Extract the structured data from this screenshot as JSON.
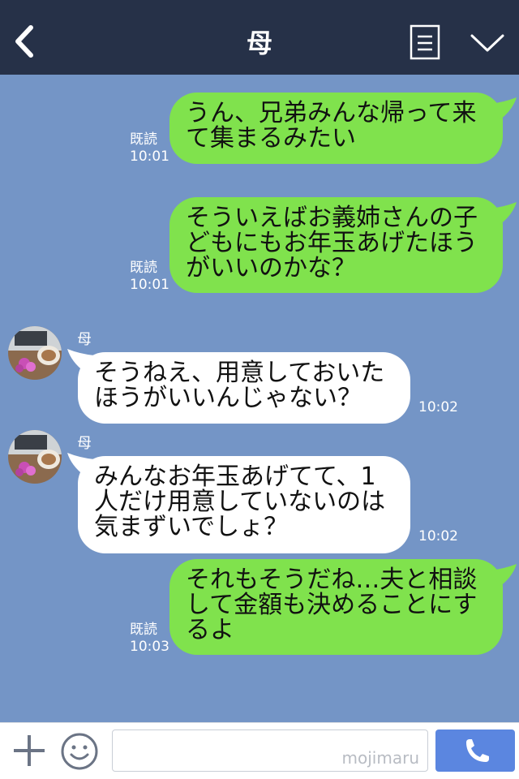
{
  "header": {
    "title": "母"
  },
  "messages": [
    {
      "from": "me",
      "lines": [
        "うん、兄弟みんな帰って来",
        "て集まるみたい"
      ],
      "read": "既読",
      "time": "10:01"
    },
    {
      "from": "me",
      "lines": [
        "そういえばお義姉さんの子",
        "どもにもお年玉あげたほう",
        "がいいのかな？"
      ],
      "read": "既読",
      "time": "10:01"
    },
    {
      "from": "them",
      "sender": "母",
      "lines": [
        "そうねえ、用意しておいた",
        "ほうがいいんじゃない？"
      ],
      "time": "10:02"
    },
    {
      "from": "them",
      "sender": "母",
      "lines": [
        "みんなお年玉あげてて、1",
        "人だけ用意していないのは",
        "気まずいでしょ？"
      ],
      "time": "10:02"
    },
    {
      "from": "me",
      "lines": [
        "それもそうだね…夫と相談",
        "して金額も決めることにす",
        "るよ"
      ],
      "read": "既読",
      "time": "10:03"
    }
  ],
  "footer": {
    "watermark": "mojimaru"
  },
  "colors": {
    "header": "#263148",
    "chat_background": "#7495c6",
    "my_bubble": "#80e24d",
    "their_bubble": "#ffffff",
    "call_button": "#5b86e0"
  },
  "icons": {
    "back": "back-arrow-icon",
    "menu": "document-menu-icon",
    "collapse": "chevron-down-icon",
    "plus": "plus-icon",
    "emoji": "smiley-icon",
    "call": "phone-icon"
  }
}
